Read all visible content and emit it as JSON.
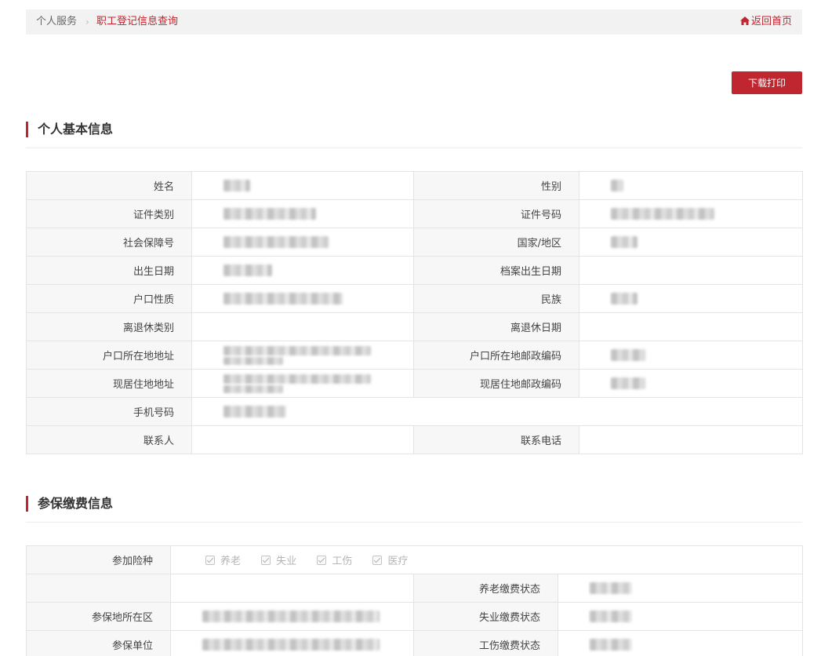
{
  "breadcrumb": {
    "home": "个人服务",
    "separator": "›",
    "current": "职工登记信息查询",
    "back": "返回首页"
  },
  "toolbar": {
    "download_label": "下载打印"
  },
  "colors": {
    "accent": "#c0262f"
  },
  "section1": {
    "title": "个人基本信息",
    "labels": {
      "name": "姓名",
      "gender": "性别",
      "id_type": "证件类别",
      "id_number": "证件号码",
      "social_security_no": "社会保障号",
      "country": "国家/地区",
      "birth_date": "出生日期",
      "archive_birth_date": "档案出生日期",
      "hukou_type": "户口性质",
      "ethnicity": "民族",
      "retirement_type": "离退休类别",
      "retirement_date": "离退休日期",
      "hukou_address": "户口所在地地址",
      "hukou_postcode": "户口所在地邮政编码",
      "current_address": "现居住地地址",
      "current_postcode": "现居住地邮政编码",
      "mobile": "手机号码",
      "contact_person": "联系人",
      "contact_phone": "联系电话"
    }
  },
  "section2": {
    "title": "参保缴费信息",
    "labels": {
      "insurance_types": "参加险种",
      "pension_status": "养老缴费状态",
      "insured_area": "参保地所在区",
      "unemployment_status": "失业缴费状态",
      "insured_unit": "参保单位",
      "injury_status": "工伤缴费状态"
    },
    "insurance_options": [
      "养老",
      "失业",
      "工伤",
      "医疗"
    ]
  }
}
